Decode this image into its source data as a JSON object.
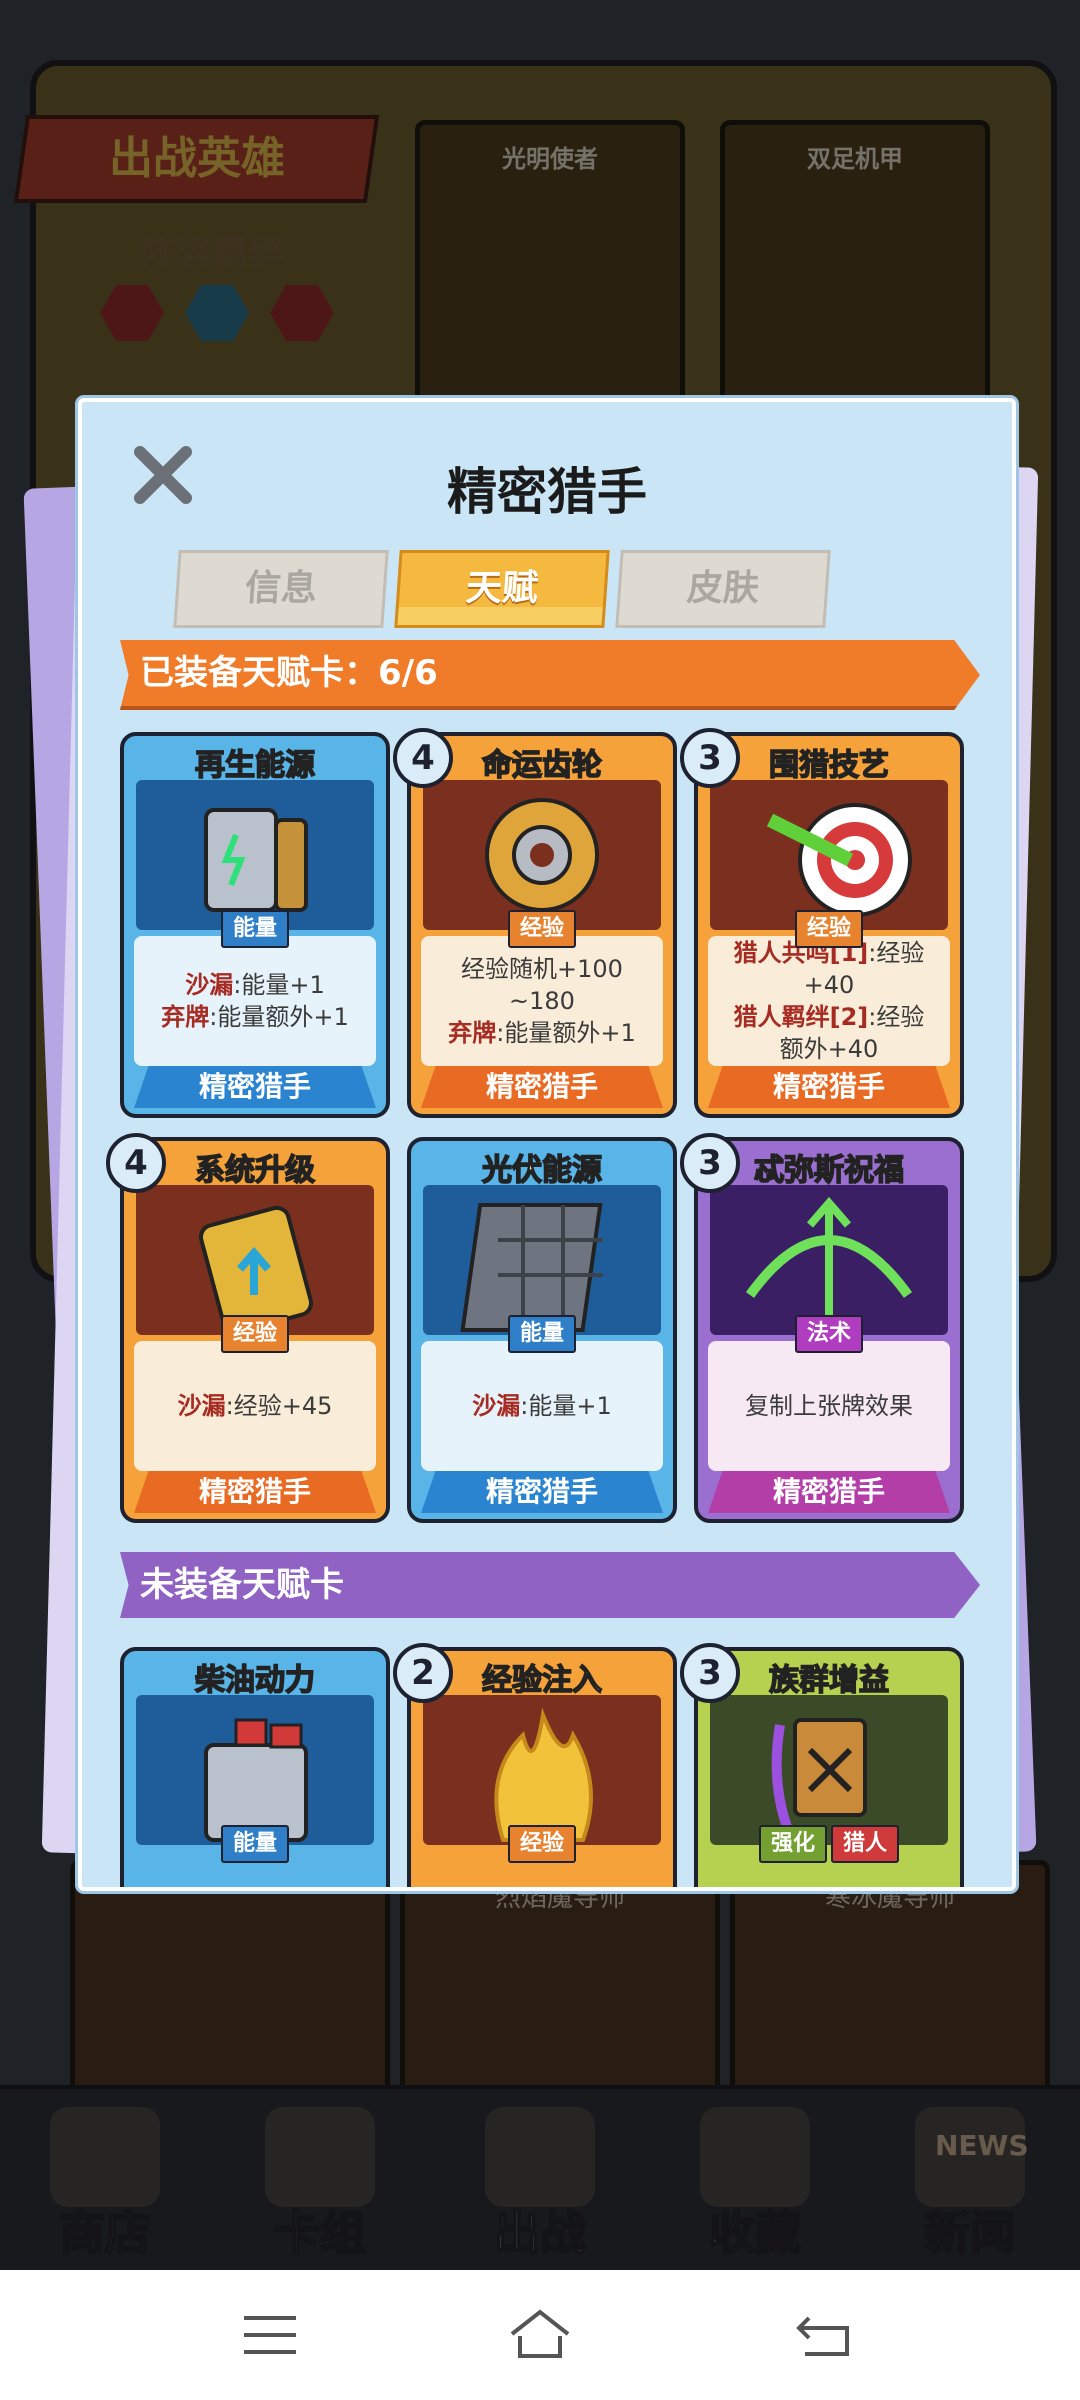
{
  "background": {
    "banner": "出战英雄",
    "bond_label": "阵容羁绊",
    "heroes_top": [
      "光明使者",
      "双足机甲"
    ],
    "heroes_bottom": [
      "",
      "烈焰魔导师",
      "寒冰魔导师"
    ],
    "bottom_tabs": [
      {
        "label": "商店",
        "icon": "shop-icon"
      },
      {
        "label": "卡组",
        "icon": "deck-icon"
      },
      {
        "label": "出战",
        "icon": "battle-icon"
      },
      {
        "label": "收藏",
        "icon": "collection-icon"
      },
      {
        "label": "新闻",
        "icon": "news-icon",
        "badge": "NEWS"
      }
    ]
  },
  "modal": {
    "title": "精密猎手",
    "tabs": [
      {
        "label": "信息",
        "active": false
      },
      {
        "label": "天赋",
        "active": true
      },
      {
        "label": "皮肤",
        "active": false
      }
    ],
    "equipped_header": "已装备天赋卡：6/6",
    "unequipped_header": "未装备天赋卡"
  },
  "equipped_cards": [
    {
      "name": "再生能源",
      "cost": "",
      "type": "能量",
      "color": "blue",
      "lines": [
        {
          "kw": "沙漏",
          "text": ":能量+1"
        },
        {
          "kw": "弃牌",
          "text": ":能量额外+1"
        }
      ],
      "owner": "精密猎手",
      "art": "battery-icon"
    },
    {
      "name": "命运齿轮",
      "cost": "4",
      "type": "经验",
      "color": "orange",
      "lines": [
        {
          "kw": "",
          "text": "经验随机+100"
        },
        {
          "kw": "",
          "text": "~180"
        },
        {
          "kw": "弃牌",
          "text": ":能量额外+1"
        }
      ],
      "owner": "精密猎手",
      "art": "gear-icon"
    },
    {
      "name": "围猎技艺",
      "cost": "3",
      "type": "经验",
      "color": "orange",
      "lines": [
        {
          "kw": "猎人共鸣[1]",
          "text": ":经验"
        },
        {
          "kw": "",
          "text": "+40"
        },
        {
          "kw": "猎人羁绊[2]",
          "text": ":经验"
        },
        {
          "kw": "",
          "text": "额外+40"
        }
      ],
      "owner": "精密猎手",
      "art": "target-icon"
    },
    {
      "name": "系统升级",
      "cost": "4",
      "type": "经验",
      "color": "orange",
      "lines": [
        {
          "kw": "沙漏",
          "text": ":经验+45"
        }
      ],
      "owner": "精密猎手",
      "art": "chip-upgrade-icon"
    },
    {
      "name": "光伏能源",
      "cost": "",
      "type": "能量",
      "color": "blue",
      "lines": [
        {
          "kw": "沙漏",
          "text": ":能量+1"
        }
      ],
      "owner": "精密猎手",
      "art": "solar-panel-icon"
    },
    {
      "name": "忒弥斯祝福",
      "cost": "3",
      "type": "法术",
      "color": "purple",
      "lines": [
        {
          "kw": "",
          "text": "复制上张牌效果"
        }
      ],
      "owner": "精密猎手",
      "art": "bow-icon"
    }
  ],
  "unequipped_cards": [
    {
      "name": "柴油动力",
      "cost": "",
      "types": [
        "能量"
      ],
      "color": "blue",
      "art": "engine-icon"
    },
    {
      "name": "经验注入",
      "cost": "2",
      "types": [
        "经验"
      ],
      "color": "orange",
      "art": "flame-icon"
    },
    {
      "name": "族群增益",
      "cost": "3",
      "types": [
        "强化",
        "猎人"
      ],
      "color": "green",
      "art": "banner-icon"
    }
  ]
}
